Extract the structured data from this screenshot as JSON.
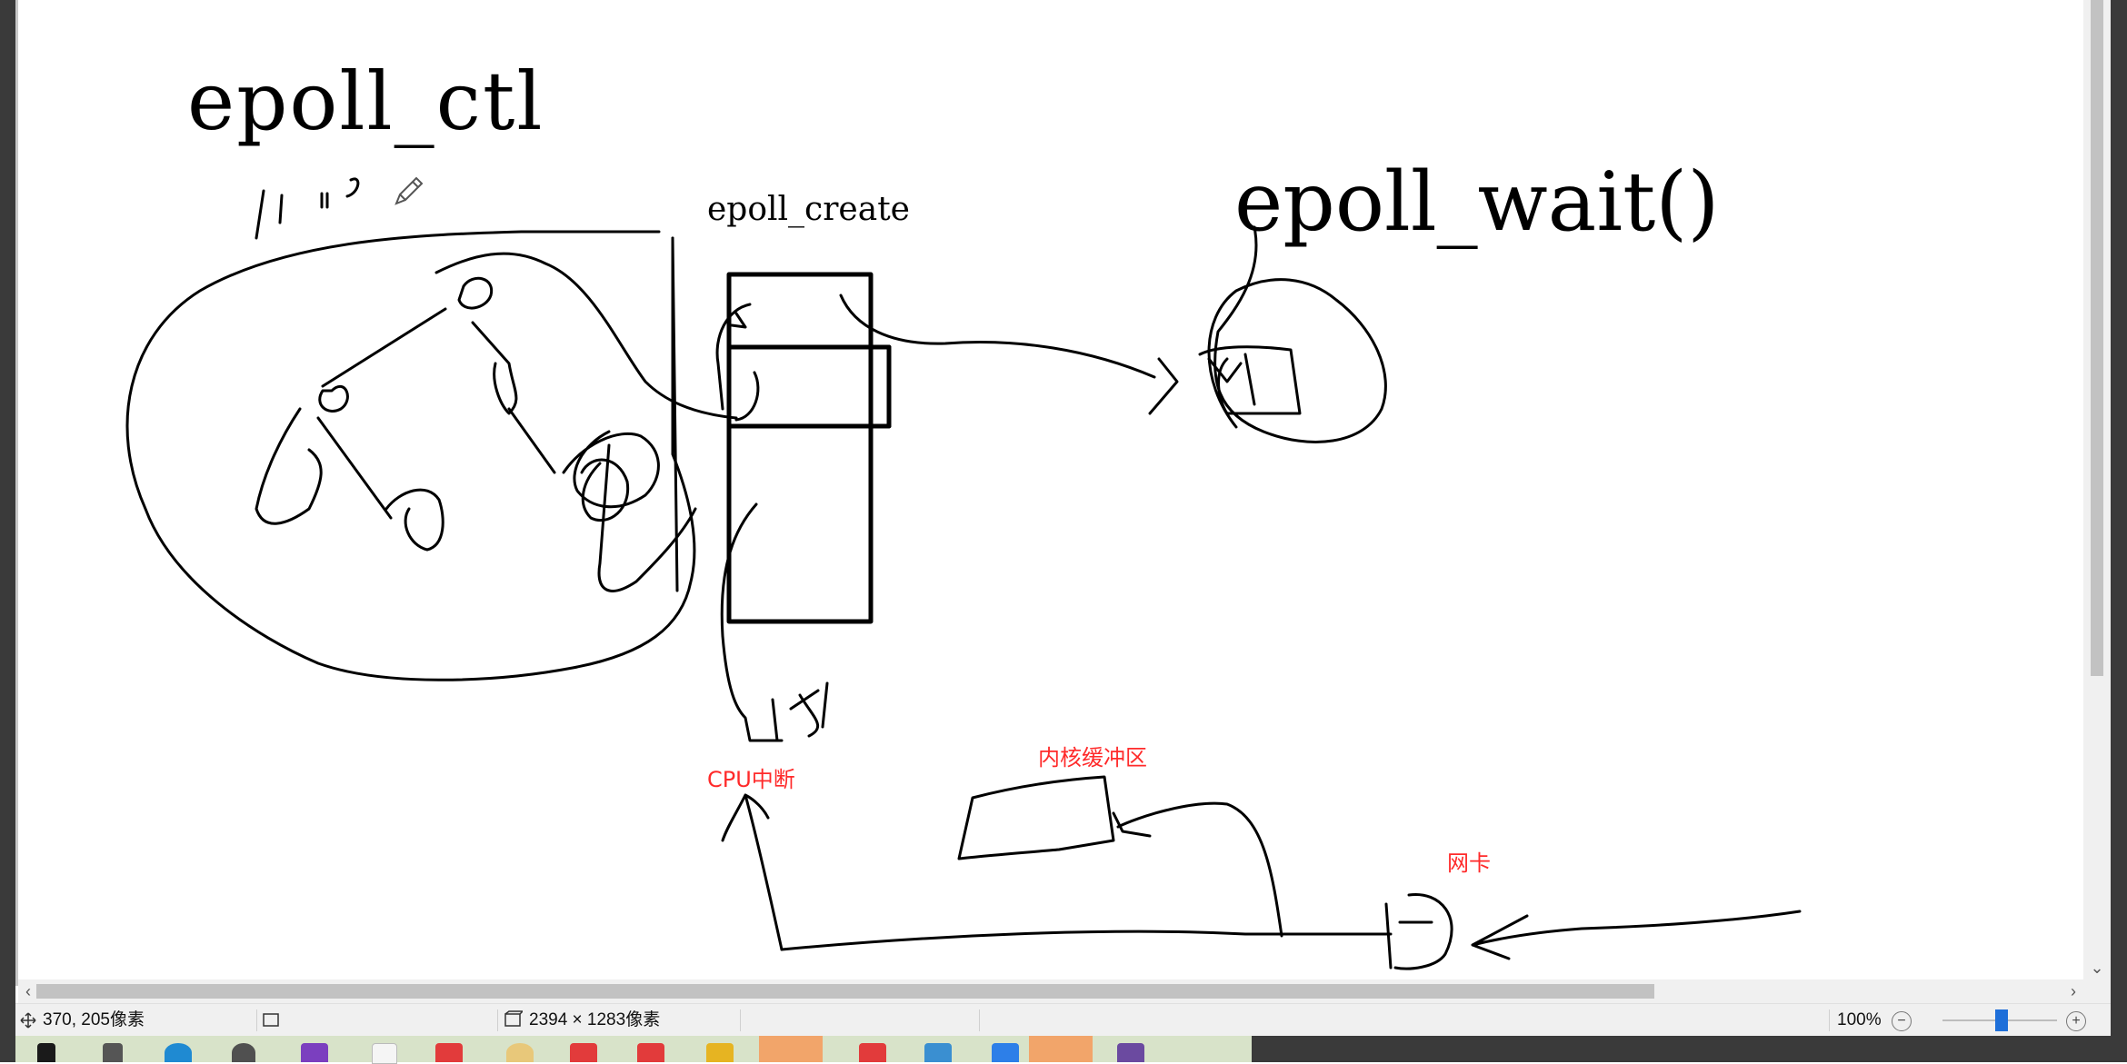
{
  "canvas": {
    "labels": {
      "epoll_ctl": "epoll_ctl",
      "epoll_create": "epoll_create",
      "epoll_wait": "epoll_wait()",
      "cpu_interrupt": "CPU中断",
      "kernel_buffer": "内核缓冲区",
      "network_card": "网卡"
    },
    "annotation_color": "#ff2a2a",
    "ink_color": "#000000"
  },
  "statusbar": {
    "cursor_position": "370, 205像素",
    "image_size": "2394 × 1283像素",
    "zoom": "100%",
    "zoom_out": "−",
    "zoom_in": "+"
  },
  "scrollbars": {
    "left_arrow": "‹",
    "right_arrow": "›",
    "down_arrow": "⌄"
  },
  "taskbar": {
    "icons": [
      "windows-start-icon",
      "task-view-icon",
      "edge-icon",
      "settings-icon",
      "visual-studio-icon",
      "typora-icon",
      "xmind-icon",
      "paint-icon",
      "xmind-icon-2",
      "xmind-icon-3",
      "file-explorer-icon",
      "wechat-icon",
      "xmind-icon-4",
      "vmware-icon",
      "feishu-icon",
      "browser-icon",
      "terminal-icon"
    ]
  }
}
